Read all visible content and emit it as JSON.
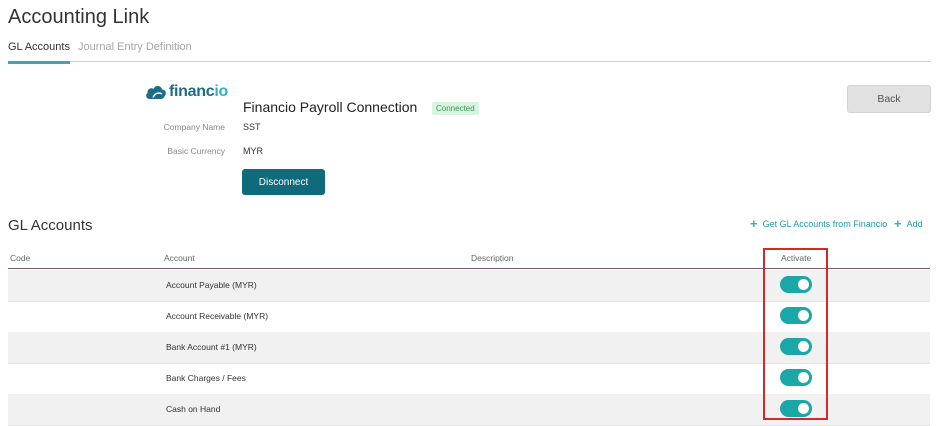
{
  "page": {
    "title": "Accounting Link"
  },
  "tabs": [
    {
      "label": "GL Accounts",
      "active": true
    },
    {
      "label": "Journal Entry Definition",
      "active": false
    }
  ],
  "connection": {
    "logo_text_main": "financ",
    "logo_text_accent": "io",
    "title": "Financio Payroll Connection",
    "status": "Connected",
    "fields": [
      {
        "label": "Company Name",
        "value": "SST"
      },
      {
        "label": "Basic Currency",
        "value": "MYR"
      }
    ],
    "disconnect_label": "Disconnect"
  },
  "back_label": "Back",
  "gl_section": {
    "title": "GL Accounts",
    "get_accounts_label": "Get GL Accounts from Financio",
    "add_label": "Add"
  },
  "table": {
    "headers": {
      "code": "Code",
      "account": "Account",
      "description": "Description",
      "activate": "Activate"
    },
    "rows": [
      {
        "code": "",
        "account": "Account Payable (MYR)",
        "description": "",
        "active": true
      },
      {
        "code": "",
        "account": "Account Receivable (MYR)",
        "description": "",
        "active": true
      },
      {
        "code": "",
        "account": "Bank Account #1 (MYR)",
        "description": "",
        "active": true
      },
      {
        "code": "",
        "account": "Bank Charges / Fees",
        "description": "",
        "active": true
      },
      {
        "code": "",
        "account": "Cash on Hand",
        "description": "",
        "active": true
      }
    ]
  },
  "colors": {
    "accent": "#3aa5b3",
    "toggle_on": "#1aa7a7",
    "button_dark": "#0f6b7b",
    "highlight": "#d62828"
  }
}
